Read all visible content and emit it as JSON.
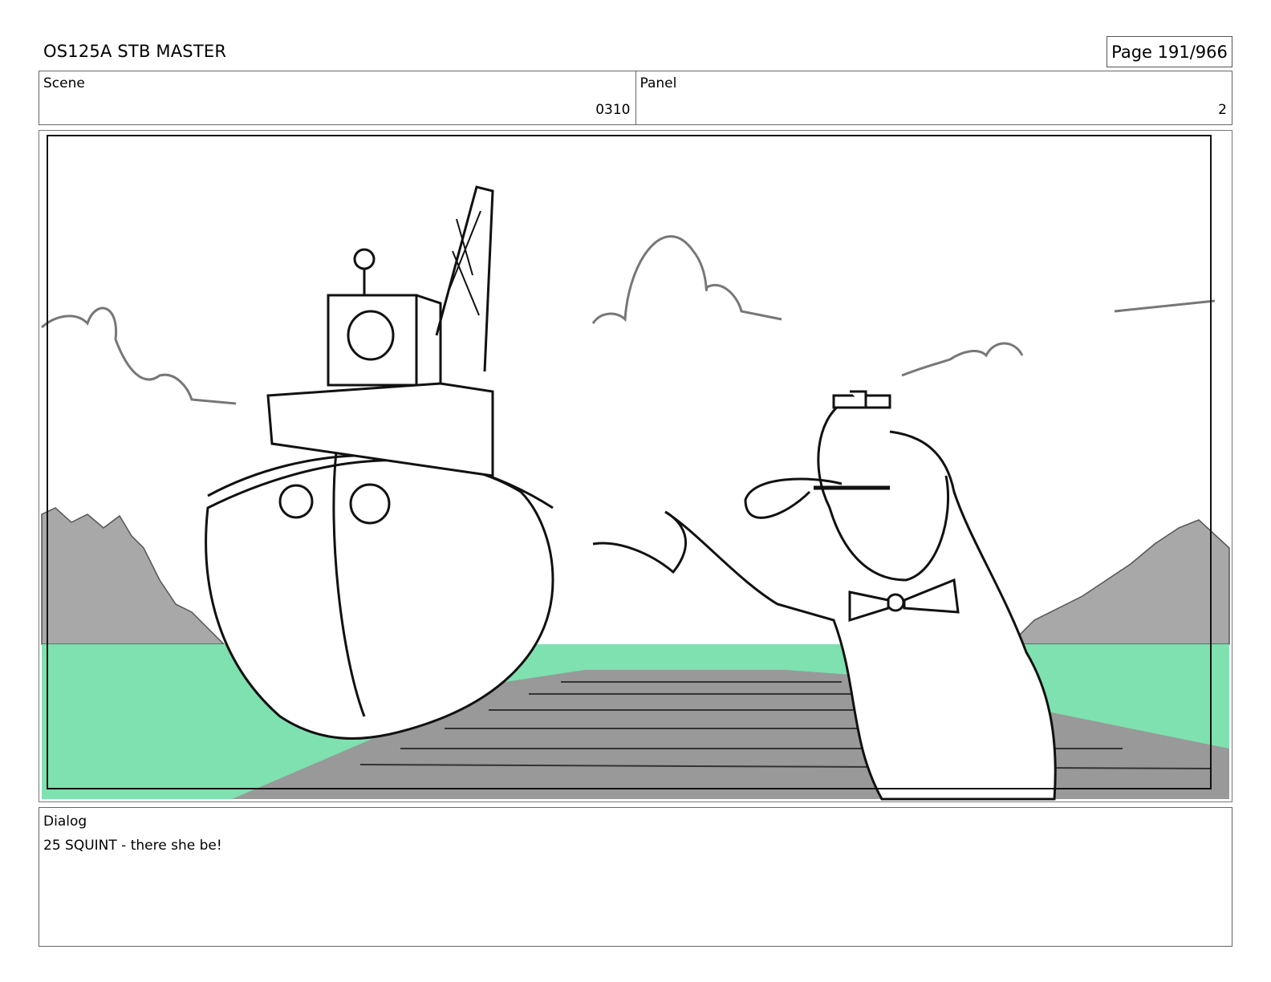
{
  "header": {
    "title": "OS125A STB MASTER",
    "page": "Page 191/966"
  },
  "info": {
    "scene_label": "Scene",
    "scene_value": "0310",
    "panel_label": "Panel",
    "panel_value": "2"
  },
  "dialog": {
    "label": "Dialog",
    "text": "25 SQUINT - there she be!"
  },
  "colors": {
    "water": "#7fe0b0",
    "hills": "#a8a8a8",
    "dock": "#999999",
    "ink": "#111111"
  }
}
